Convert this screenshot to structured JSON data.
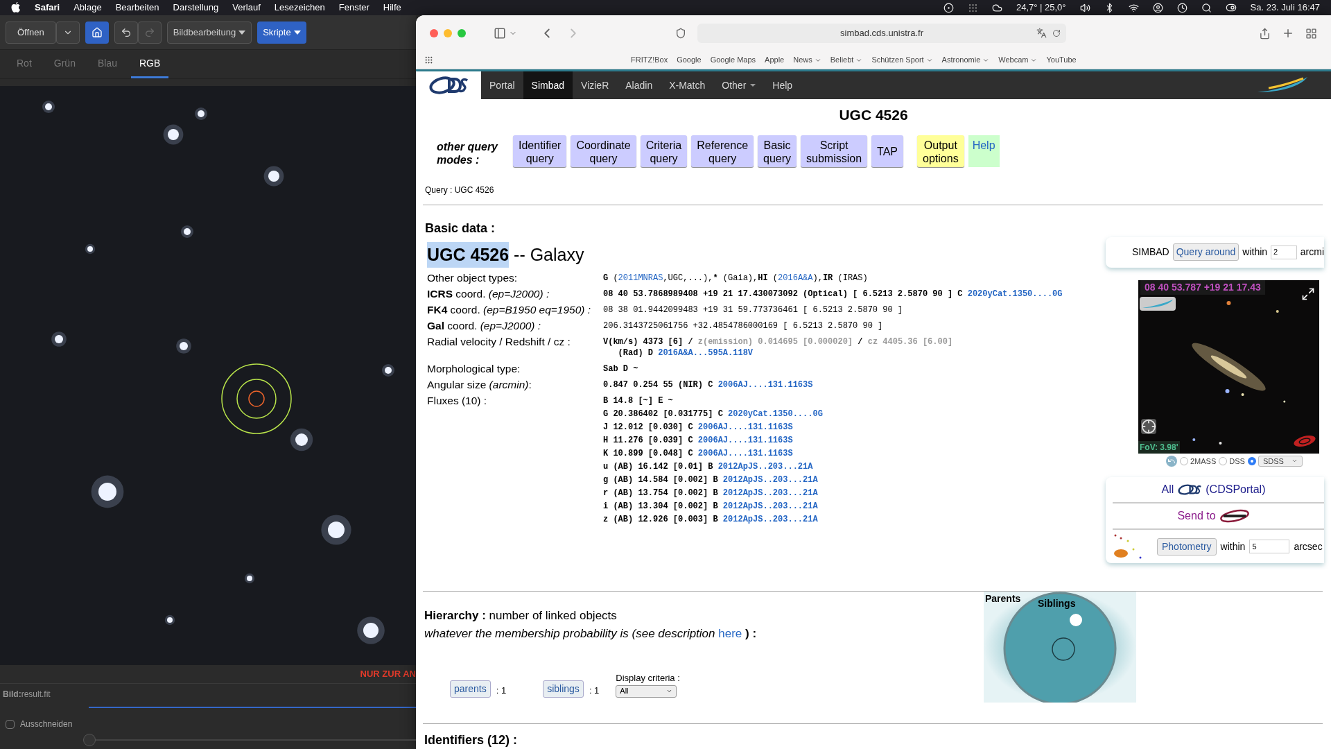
{
  "menu_bar": {
    "app": "Safari",
    "items": [
      "Ablage",
      "Bearbeiten",
      "Darstellung",
      "Verlauf",
      "Lesezeichen",
      "Fenster",
      "Hilfe"
    ],
    "weather": "24,7° | 25,0°",
    "clock": "Sa. 23. Juli 16:47"
  },
  "image_app": {
    "toolbar": {
      "open": "Öffnen",
      "image_menu": "Bildbearbeitung",
      "scripts_menu": "Skripte"
    },
    "tabs": [
      {
        "label": "Rot",
        "selected": false
      },
      {
        "label": "Grün",
        "selected": false
      },
      {
        "label": "Blau",
        "selected": false
      },
      {
        "label": "RGB",
        "selected": true
      }
    ],
    "overlay_text": "NUR ZUR AN",
    "file_label": "**Bild:**result.fit",
    "crop": {
      "label": "Ausschneiden",
      "checked": false
    }
  },
  "browser": {
    "address": "simbad.cds.unistra.fr",
    "bookmarks": [
      {
        "label": "FRITZ!Box",
        "dropdown": false
      },
      {
        "label": "Google",
        "dropdown": false
      },
      {
        "label": "Google Maps",
        "dropdown": false
      },
      {
        "label": "Apple",
        "dropdown": false
      },
      {
        "label": "News",
        "dropdown": true
      },
      {
        "label": "Beliebt",
        "dropdown": true
      },
      {
        "label": "Schützen Sport",
        "dropdown": true
      },
      {
        "label": "Astronomie",
        "dropdown": true
      },
      {
        "label": "Webcam",
        "dropdown": true
      },
      {
        "label": "YouTube",
        "dropdown": false
      }
    ]
  },
  "site_nav": [
    {
      "label": "Portal",
      "selected": false,
      "dropdown": false
    },
    {
      "label": "Simbad",
      "selected": true,
      "dropdown": false
    },
    {
      "label": "VizieR",
      "selected": false,
      "dropdown": false
    },
    {
      "label": "Aladin",
      "selected": false,
      "dropdown": false
    },
    {
      "label": "X-Match",
      "selected": false,
      "dropdown": false
    },
    {
      "label": "Other",
      "selected": false,
      "dropdown": true
    },
    {
      "label": "Help",
      "selected": false,
      "dropdown": false
    }
  ],
  "page_title": "UGC 4526",
  "query_modes_label": "other query modes :",
  "query_modes": [
    {
      "label": "Identifier query",
      "color": "#ccccff"
    },
    {
      "label": "Coordinate query",
      "color": "#ccccff"
    },
    {
      "label": "Criteria query",
      "color": "#ccccff"
    },
    {
      "label": "Reference query",
      "color": "#ccccff"
    },
    {
      "label": "Basic query",
      "color": "#ccccff"
    },
    {
      "label": "Script submission",
      "color": "#ccccff"
    },
    {
      "label": "TAP",
      "color": "#ccccff"
    }
  ],
  "extra_buttons": [
    {
      "label": "Output options",
      "color": "#ffff99",
      "kind": "button"
    },
    {
      "label": "Help",
      "color": "#ccffcc",
      "kind": "link"
    }
  ],
  "query_text": "Query : UGC 4526",
  "basic_data": {
    "heading": "Basic data :",
    "name": "UGC 4526",
    "type": " -- Galaxy",
    "rows": [
      {
        "label": "Other object types:",
        "lines": [
          [
            {
              "text": "G",
              "kind": "bold"
            },
            {
              "text": " (",
              "kind": "plain"
            },
            {
              "text": "2011MNRAS",
              "kind": "link-light"
            },
            {
              "text": ",UGC,...),",
              "kind": "plain"
            },
            {
              "text": "* ",
              "kind": "bold"
            },
            {
              "text": "(Gaia),",
              "kind": "plain"
            },
            {
              "text": "HI",
              "kind": "bold"
            },
            {
              "text": " (",
              "kind": "plain"
            },
            {
              "text": "2016A&A",
              "kind": "link-light"
            },
            {
              "text": "),",
              "kind": "plain"
            },
            {
              "text": "IR",
              "kind": "bold"
            },
            {
              "text": " (IRAS)",
              "kind": "plain"
            }
          ]
        ]
      },
      {
        "label": "**ICRS** coord. *(ep=J2000) :*",
        "lines": [
          [
            {
              "text": "08 40 53.7868989408 +19 21 17.430073092 (Optical) [ 6.5213 2.5870 90 ] C ",
              "kind": "bold"
            },
            {
              "text": "2020yCat.1350....0G",
              "kind": "link"
            }
          ]
        ]
      },
      {
        "label": "**FK4** coord. *(ep=B1950 eq=1950) :*",
        "lines": [
          [
            {
              "text": "08 38 01.9442099483 +19 31 59.773736461 [ 6.5213 2.5870 90 ]",
              "kind": "plain"
            }
          ]
        ]
      },
      {
        "label": "**Gal** coord. *(ep=J2000) :*",
        "lines": [
          [
            {
              "text": "206.3143725061756 +32.4854786000169 [ 6.5213 2.5870 90 ]",
              "kind": "plain"
            }
          ]
        ]
      },
      {
        "label": "Radial velocity / Redshift / cz :",
        "lines": [
          [
            {
              "text": "V(km/s) 4373 [6] / ",
              "kind": "bold"
            },
            {
              "text": "z(emission) 0.014695 [0.000020]",
              "kind": "muted"
            },
            {
              "text": " / ",
              "kind": "bold"
            },
            {
              "text": "cz 4405.36 [6.00]",
              "kind": "muted"
            }
          ],
          [
            {
              "text": "   (Rad) D ",
              "kind": "bold"
            },
            {
              "text": "2016A&A...595A.118V",
              "kind": "link"
            }
          ]
        ]
      },
      {
        "label": "Morphological type:",
        "lines": [
          [
            {
              "text": "Sab D ~",
              "kind": "bold"
            }
          ]
        ]
      },
      {
        "label": "Angular size *(arcmin)*:",
        "lines": [
          [
            {
              "text": "0.847 0.254 55 (NIR) C ",
              "kind": "bold"
            },
            {
              "text": "2006AJ....131.1163S",
              "kind": "link"
            }
          ]
        ]
      },
      {
        "label": "Fluxes (10) :",
        "lines": [
          [
            {
              "text": "B 14.8 [~] E ~",
              "kind": "bold"
            }
          ],
          [
            {
              "text": "G 20.386402 [0.031775] C ",
              "kind": "bold"
            },
            {
              "text": "2020yCat.1350....0G",
              "kind": "link"
            }
          ],
          [
            {
              "text": "J 12.012 [0.030] C ",
              "kind": "bold"
            },
            {
              "text": "2006AJ....131.1163S",
              "kind": "link"
            }
          ],
          [
            {
              "text": "H 11.276 [0.039] C ",
              "kind": "bold"
            },
            {
              "text": "2006AJ....131.1163S",
              "kind": "link"
            }
          ],
          [
            {
              "text": "K 10.899 [0.048] C ",
              "kind": "bold"
            },
            {
              "text": "2006AJ....131.1163S",
              "kind": "link"
            }
          ],
          [
            {
              "text": "u (AB) 16.142 [0.01] B ",
              "kind": "bold"
            },
            {
              "text": "2012ApJS..203...21A",
              "kind": "link"
            }
          ],
          [
            {
              "text": "g (AB) 14.584 [0.002] B ",
              "kind": "bold"
            },
            {
              "text": "2012ApJS..203...21A",
              "kind": "link"
            }
          ],
          [
            {
              "text": "r (AB) 13.754 [0.002] B ",
              "kind": "bold"
            },
            {
              "text": "2012ApJS..203...21A",
              "kind": "link"
            }
          ],
          [
            {
              "text": "i (AB) 13.304 [0.002] B ",
              "kind": "bold"
            },
            {
              "text": "2012ApJS..203...21A",
              "kind": "link"
            }
          ],
          [
            {
              "text": "z (AB) 12.926 [0.003] B ",
              "kind": "bold"
            },
            {
              "text": "2012ApJS..203...21A",
              "kind": "link"
            }
          ]
        ]
      }
    ]
  },
  "side_panel": {
    "simbad_label": "SIMBAD",
    "query_around": "Query around",
    "within": "within",
    "radius": "2",
    "unit": "arcmi",
    "sky_view": {
      "coordinates": "08 40 53.787 +19 21 17.43",
      "fov": "FoV: 3.98'"
    },
    "surveys": [
      {
        "label": "2MASS",
        "selected": false,
        "kind": "radio"
      },
      {
        "label": "DSS",
        "selected": false,
        "kind": "radio"
      },
      {
        "label": "SDSS",
        "selected": true,
        "kind": "select"
      }
    ],
    "all_label": "All",
    "portal_label": "(CDSPortal)",
    "send_to": "Send to",
    "photometry": "Photometry",
    "photometry_within": "within",
    "photometry_radius": "5",
    "photometry_unit": "arcsec"
  },
  "hierarchy": {
    "heading": "**Hierarchy :** number of linked objects",
    "note": "whatever the membership probability is (see description ",
    "link": "here",
    "note_end": " ) :",
    "parents": {
      "label": "parents",
      "count": ": 1"
    },
    "siblings": {
      "label": "siblings",
      "count": ": 1"
    },
    "criteria_label": "Display criteria :",
    "criteria_value": "All",
    "diagram": {
      "parents_label": "Parents",
      "siblings_label": "Siblings"
    }
  },
  "identifiers_heading": "Identifiers (12) :"
}
